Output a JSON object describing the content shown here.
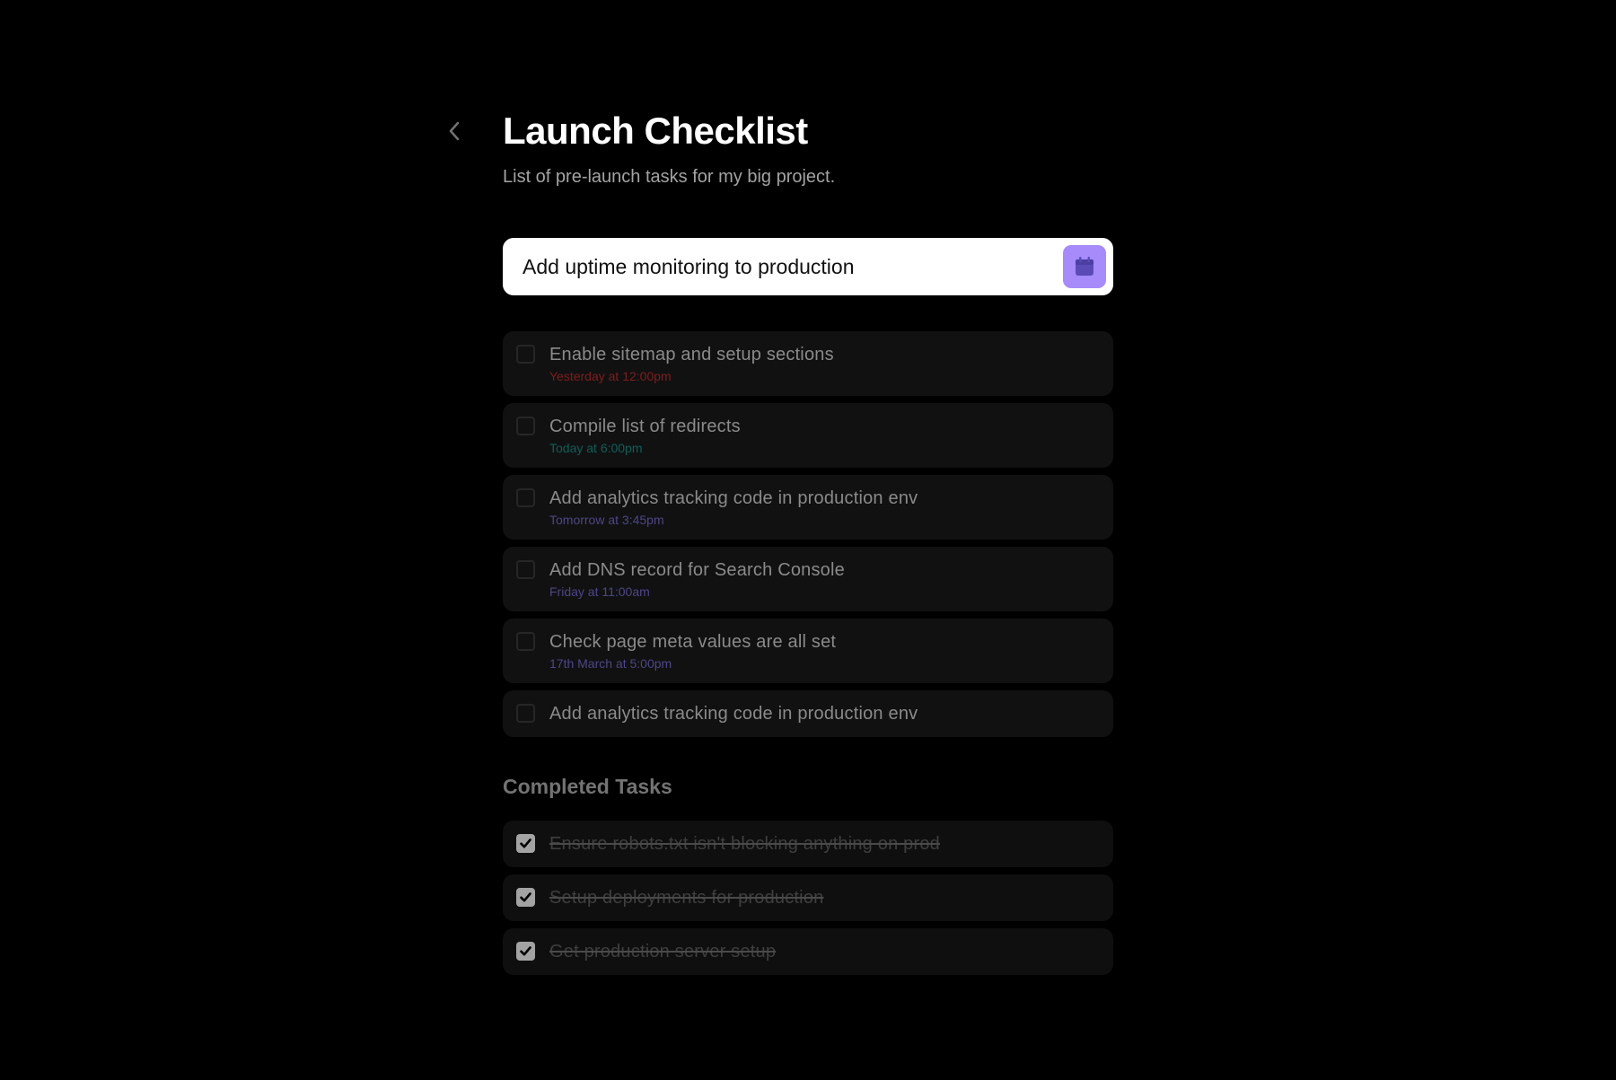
{
  "page": {
    "title": "Launch Checklist",
    "subtitle": "List of pre-launch tasks for my big project."
  },
  "new_task": {
    "value": "Add uptime monitoring to production",
    "date_button_icon": "calendar-icon",
    "accent_color": "#a78bfa"
  },
  "tasks": [
    {
      "title": "Enable sitemap and setup sections",
      "due": "Yesterday at 12:00pm",
      "due_color": "#7f1d1d"
    },
    {
      "title": "Compile list of redirects",
      "due": "Today at 6:00pm",
      "due_color": "#115e59"
    },
    {
      "title": "Add analytics tracking code in production env",
      "due": "Tomorrow at 3:45pm",
      "due_color": "#4c4687"
    },
    {
      "title": "Add DNS record for Search Console",
      "due": "Friday at 11:00am",
      "due_color": "#4c4687"
    },
    {
      "title": "Check page meta values are all set",
      "due": "17th March at 5:00pm",
      "due_color": "#4c4687"
    },
    {
      "title": "Add analytics tracking code in production env"
    }
  ],
  "completed": {
    "heading": "Completed Tasks",
    "tasks": [
      {
        "title": "Ensure robots.txt isn't blocking anything on prod"
      },
      {
        "title": "Setup deployments for production"
      },
      {
        "title": "Get production server setup"
      }
    ]
  },
  "icons": {
    "back": "chevron-left-icon",
    "checkmark": "checkmark-icon"
  }
}
